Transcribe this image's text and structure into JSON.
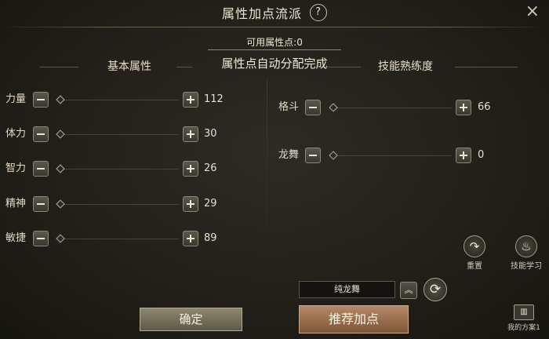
{
  "header": {
    "title": "属性加点流派",
    "help_glyph": "?",
    "close_glyph": "×"
  },
  "available_points": "可用属性点:0",
  "auto_message": "属性点自动分配完成",
  "basic": {
    "heading": "基本属性",
    "rows": [
      {
        "label": "力量",
        "value": "112"
      },
      {
        "label": "体力",
        "value": "30"
      },
      {
        "label": "智力",
        "value": "26"
      },
      {
        "label": "精神",
        "value": "29"
      },
      {
        "label": "敏捷",
        "value": "89"
      }
    ]
  },
  "skills": {
    "heading": "技能熟练度",
    "rows": [
      {
        "label": "格斗",
        "value": "66"
      },
      {
        "label": "龙舞",
        "value": "0"
      }
    ]
  },
  "reset": {
    "label": "重置",
    "icon": "reset-arrow-icon"
  },
  "skill_learn": {
    "label": "技能学习",
    "icon": "flame-skill-icon"
  },
  "scheme_name": "纯龙舞",
  "confirm_label": "确定",
  "recommend_label": "推荐加点",
  "my_plan_label": "我的方案1",
  "colors": {
    "recommend": "#9a6e4f",
    "confirm": "#77725d",
    "background": "#211f19"
  }
}
